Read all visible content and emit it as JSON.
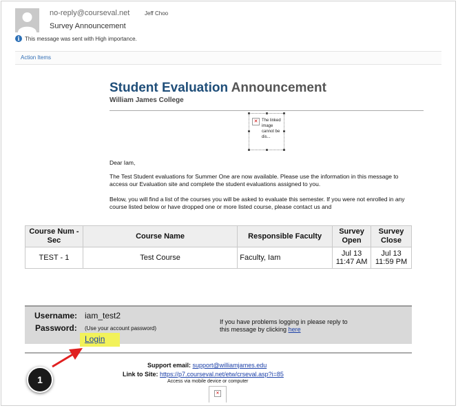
{
  "header": {
    "from": "no-reply@courseval.net",
    "to": "Jeff Choo",
    "subject": "Survey Announcement",
    "importance": "This message was sent with High importance.",
    "action_items": "Action Items"
  },
  "body": {
    "title_part1": "Student Evaluation",
    "title_part2": "Announcement",
    "college": "William James College",
    "broken_image_text": "The linked image cannot be dis...",
    "greeting": "Dear Iam,",
    "para1": "The Test Student evaluations for Summer One are now available. Please use the information in this message to access our Evaluation site and complete the student evaluations assigned to you.",
    "para2": "Below, you will find a list of the courses you will be asked to evaluate this semester. If you were not enrolled in any course listed below or have dropped one or more listed course, please contact us and"
  },
  "table": {
    "headers": [
      "Course Num - Sec",
      "Course Name",
      "Responsible Faculty",
      "Survey Open",
      "Survey Close"
    ],
    "rows": [
      [
        "TEST - 1",
        "Test Course",
        "Faculty, Iam",
        "Jul 13 11:47 AM",
        "Jul 13 11:59 PM"
      ]
    ]
  },
  "login": {
    "username_label": "Username:",
    "username_value": "iam_test2",
    "password_label": "Password:",
    "password_note": "(Use your account password)",
    "login_link": "Login",
    "help_text": "If you have problems logging in please reply to this message by clicking",
    "help_link": "here"
  },
  "footer": {
    "support_label": "Support email:",
    "support_email": "support@williamjames.edu",
    "site_label": "Link to Site:",
    "site_url": "https://p7.courseval.net/etw/crseval.asp?i=85",
    "mobile_note": "Access via mobile device or computer"
  },
  "annotation": {
    "step_number": "1",
    "color": "#e02020"
  },
  "colors": {
    "title_blue": "#1f4e79",
    "link_blue": "#1a3fa8",
    "highlight": "#f2f25a"
  }
}
